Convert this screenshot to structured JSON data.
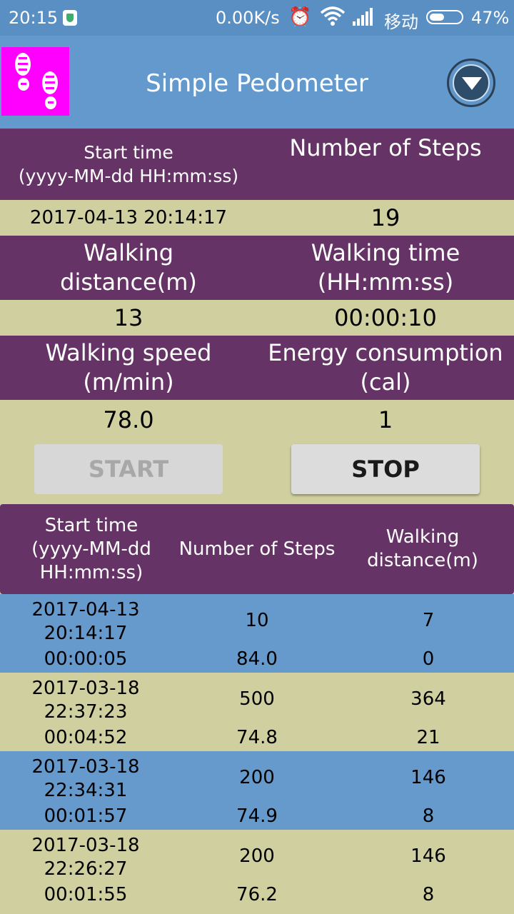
{
  "status_bar": {
    "time": "20:15",
    "network_speed": "0.00K/s",
    "carrier": "移动",
    "battery_percent_text": "47%",
    "battery_level": 0.47,
    "icons": [
      "shield-icon",
      "alarm-icon",
      "wifi-icon",
      "signal-icon",
      "battery-icon"
    ]
  },
  "app_bar": {
    "title": "Simple Pedometer",
    "logo_icon": "footprints-icon",
    "menu_icon": "dropdown-circle-icon"
  },
  "summary": {
    "start_time_label_1": "Start time",
    "start_time_label_2": "(yyyy-MM-dd HH:mm:ss)",
    "steps_label": "Number of Steps",
    "start_time_value": "2017-04-13 20:14:17",
    "steps_value": "19",
    "distance_label_1": "Walking",
    "distance_label_2": "distance(m)",
    "walk_time_label_1": "Walking time",
    "walk_time_label_2": "(HH:mm:ss)",
    "distance_value": "13",
    "walk_time_value": "00:00:10",
    "speed_label_1": "Walking speed",
    "speed_label_2": "(m/min)",
    "energy_label_1": "Energy consumption",
    "energy_label_2": "(cal)",
    "speed_value": "78.0",
    "energy_value": "1"
  },
  "buttons": {
    "start": "START",
    "stop": "STOP"
  },
  "history": {
    "headers": {
      "start_1": "Start time",
      "start_2": "(yyyy-MM-dd",
      "start_3": "HH:mm:ss)",
      "steps": "Number of Steps",
      "distance_1": "Walking",
      "distance_2": "distance(m)"
    },
    "rows": [
      {
        "date": "2017-04-13",
        "time": "20:14:17",
        "duration": "00:00:05",
        "steps": "10",
        "speed": "84.0",
        "distance": "7",
        "energy": "0"
      },
      {
        "date": "2017-03-18",
        "time": "22:37:23",
        "duration": "00:04:52",
        "steps": "500",
        "speed": "74.8",
        "distance": "364",
        "energy": "21"
      },
      {
        "date": "2017-03-18",
        "time": "22:34:31",
        "duration": "00:01:57",
        "steps": "200",
        "speed": "74.9",
        "distance": "146",
        "energy": "8"
      },
      {
        "date": "2017-03-18",
        "time": "22:26:27",
        "duration": "00:01:55",
        "steps": "200",
        "speed": "76.2",
        "distance": "146",
        "energy": "8"
      }
    ]
  },
  "colors": {
    "status_bar": "#5a8fc4",
    "app_bar": "#6399cc",
    "header_purple": "#663366",
    "value_khaki": "#cfcf9f",
    "row_blue": "#6699cc",
    "logo_magenta": "#ff00ff"
  }
}
